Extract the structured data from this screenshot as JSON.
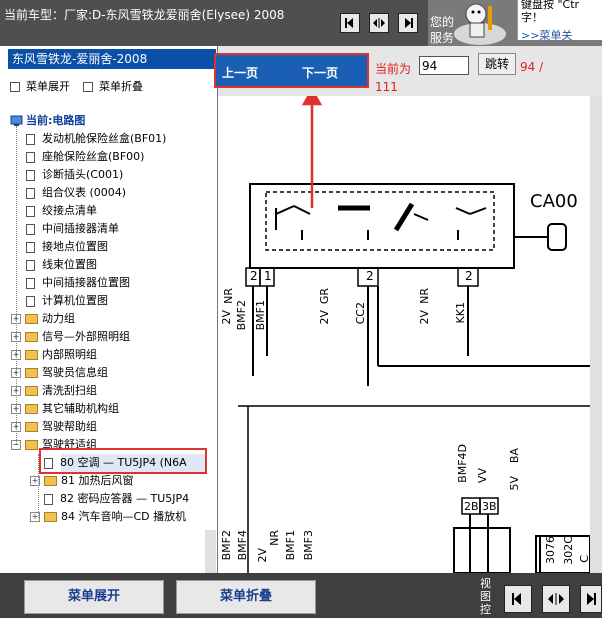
{
  "header": {
    "car_model_label": "当前车型：厂家:D-东风雪铁龙爱丽舍(Elysee) 2008",
    "tip_text_line1": "您的",
    "tip_text_line2": "服务",
    "tip_box_line1": "键盘按 \"Ctr",
    "tip_box_line2": "字！",
    "tip_link": ">>菜单关"
  },
  "sidebar": {
    "title": "东风雪铁龙-爱丽舍-2008",
    "expand_label": "菜单展开",
    "collapse_label": "菜单折叠",
    "root_label": "当前:电路图",
    "leaves": [
      "发动机舱保险丝盒(BF01)",
      "座舱保险丝盒(BF00)",
      "诊断插头(C001)",
      "组合仪表 (0004)",
      "绞接点清单",
      "中间插接器清单",
      "接地点位置图",
      "线束位置图",
      "中间插接器位置图",
      "计算机位置图"
    ],
    "groups": [
      "动力组",
      "信号—外部照明组",
      "内部照明组",
      "驾驶员信息组",
      "清洗刮扫组",
      "其它辅助机构组",
      "驾驶帮助组",
      "驾驶舒适组"
    ],
    "sub_items": [
      "80 空调 — TU5JP4 (N6A",
      "81 加热后风窗",
      "82 密码应答器 — TU5JP4",
      "84 汽车音响—CD 播放机"
    ]
  },
  "pager": {
    "prev_label": "上一页",
    "next_label": "下一页",
    "current_label": "当前为",
    "page_value": "94",
    "jump_label": "跳转",
    "page_count": "94 /",
    "total_pages": "111"
  },
  "diagram": {
    "connector_id": "CA00",
    "pins": [
      "2",
      "1",
      "2",
      "2"
    ],
    "top_labels": [
      "NR",
      "GR",
      "NR"
    ],
    "wire_labels": [
      "2V",
      "BMF2",
      "BMF1",
      "2V",
      "CC2",
      "2V",
      "KK1"
    ],
    "mid_labels": [
      "BMF4D",
      "VV",
      "5V",
      "BA"
    ],
    "mid_pins": [
      "2B",
      "3B"
    ],
    "bottom_labels": [
      "BMF2",
      "BMF4",
      "2V",
      "NR",
      "BMF1",
      "BMF3",
      "3076",
      "302C",
      "C"
    ]
  },
  "footer": {
    "expand_label": "菜单展开",
    "collapse_label": "菜单折叠",
    "view_label": "视图控"
  }
}
